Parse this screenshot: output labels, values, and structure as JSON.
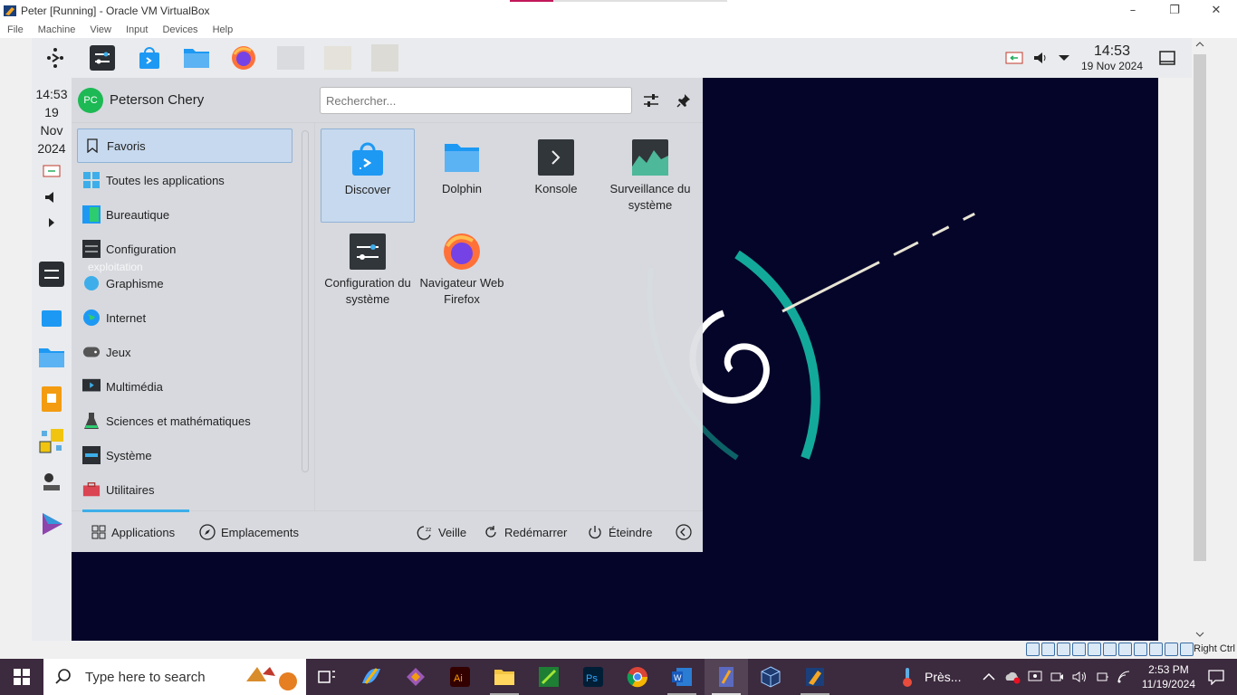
{
  "host_window": {
    "title": "Peter [Running] - Oracle VM VirtualBox",
    "controls": [
      "–",
      "❐",
      "✕"
    ]
  },
  "vbox_menu": [
    "File",
    "Machine",
    "View",
    "Input",
    "Devices",
    "Help"
  ],
  "kde_top_panel": {
    "clock_time": "14:53",
    "clock_date": "19 Nov 2024"
  },
  "kde_left_panel": {
    "time": "14:53",
    "day": "19",
    "month": "Nov",
    "year": "2024"
  },
  "launcher": {
    "user_initials": "PC",
    "user_name": "Peterson Chery",
    "search_placeholder": "Rechercher...",
    "categories": [
      {
        "label": "Favoris",
        "icon": "bookmark-icon"
      },
      {
        "label": "Toutes les applications",
        "icon": "grid-icon"
      },
      {
        "label": "Bureautique",
        "icon": "office-icon"
      },
      {
        "label": "Configuration",
        "icon": "settings-icon"
      },
      {
        "label": "Graphisme",
        "icon": "graphics-icon"
      },
      {
        "label": "Internet",
        "icon": "globe-icon"
      },
      {
        "label": "Jeux",
        "icon": "gamepad-icon"
      },
      {
        "label": "Multimédia",
        "icon": "multimedia-icon"
      },
      {
        "label": "Sciences et mathématiques",
        "icon": "science-icon"
      },
      {
        "label": "Système",
        "icon": "system-icon"
      },
      {
        "label": "Utilitaires",
        "icon": "toolbox-icon"
      }
    ],
    "ghost_text": "exploitation",
    "apps": [
      {
        "label": "Discover",
        "icon": "discover-icon"
      },
      {
        "label": "Dolphin",
        "icon": "folder-icon"
      },
      {
        "label": "Konsole",
        "icon": "terminal-icon"
      },
      {
        "label": "Surveillance du système",
        "icon": "system-monitor-icon"
      },
      {
        "label": "Configuration du système",
        "icon": "system-settings-icon"
      },
      {
        "label": "Navigateur Web Firefox",
        "icon": "firefox-icon"
      }
    ],
    "footer": {
      "applications": "Applications",
      "places": "Emplacements",
      "sleep": "Veille",
      "restart": "Redémarrer",
      "shutdown": "Éteindre"
    }
  },
  "vbox_status": {
    "host_key": "Right Ctrl"
  },
  "windows_taskbar": {
    "search_placeholder": "Type here to search",
    "weather_text": "Près...",
    "time": "2:53 PM",
    "date": "11/19/2024"
  }
}
